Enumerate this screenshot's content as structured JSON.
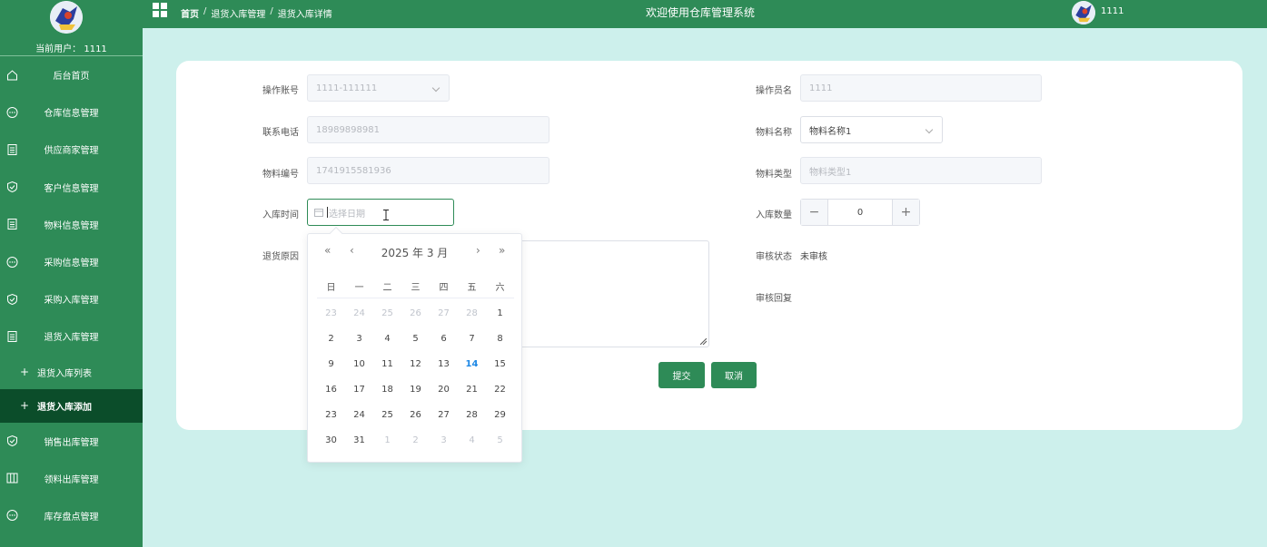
{
  "sidebar": {
    "current_user": "当前用户： 1111",
    "items": [
      {
        "label": "后台首页",
        "icon": "home-icon"
      },
      {
        "label": "仓库信息管理",
        "icon": "chat-icon"
      },
      {
        "label": "供应商家管理",
        "icon": "document-icon"
      },
      {
        "label": "客户信息管理",
        "icon": "shield-icon"
      },
      {
        "label": "物料信息管理",
        "icon": "document-icon"
      },
      {
        "label": "采购信息管理",
        "icon": "chat-icon"
      },
      {
        "label": "采购入库管理",
        "icon": "shield-icon"
      },
      {
        "label": "退货入库管理",
        "icon": "document-icon"
      }
    ],
    "subitems": [
      {
        "label": "退货入库列表"
      },
      {
        "label": "退货入库添加"
      }
    ],
    "items_after": [
      {
        "label": "销售出库管理",
        "icon": "shield-icon"
      },
      {
        "label": "领料出库管理",
        "icon": "columns-icon"
      },
      {
        "label": "库存盘点管理",
        "icon": "chat-icon"
      }
    ]
  },
  "topbar": {
    "breadcrumb": [
      "首页",
      "退货入库管理",
      "退货入库详情"
    ],
    "title": "欢迎使用仓库管理系统",
    "username": "1111"
  },
  "form": {
    "account_label": "操作账号",
    "account_value": "1111-111111",
    "operator_label": "操作员名",
    "operator_value": "1111",
    "phone_label": "联系电话",
    "phone_value": "18989898981",
    "material_name_label": "物料名称",
    "material_name_value": "物料名称1",
    "material_code_label": "物料编号",
    "material_code_value": "1741915581936",
    "material_type_label": "物料类型",
    "material_type_value": "物料类型1",
    "time_label": "入库时间",
    "time_placeholder": "选择日期",
    "qty_label": "入库数量",
    "qty_value": "0",
    "reason_label": "退货原因",
    "audit_status_label": "审核状态",
    "audit_status_value": "未审核",
    "audit_reply_label": "审核回复",
    "submit_label": "提交",
    "cancel_label": "取消"
  },
  "datepicker": {
    "title": "2025 年  3 月",
    "weekdays": [
      "日",
      "一",
      "二",
      "三",
      "四",
      "五",
      "六"
    ],
    "weeks": [
      [
        [
          "23",
          1
        ],
        [
          "24",
          1
        ],
        [
          "25",
          1
        ],
        [
          "26",
          1
        ],
        [
          "27",
          1
        ],
        [
          "28",
          1
        ],
        [
          "1",
          0
        ]
      ],
      [
        [
          "2",
          0
        ],
        [
          "3",
          0
        ],
        [
          "4",
          0
        ],
        [
          "5",
          0
        ],
        [
          "6",
          0
        ],
        [
          "7",
          0
        ],
        [
          "8",
          0
        ]
      ],
      [
        [
          "9",
          0
        ],
        [
          "10",
          0
        ],
        [
          "11",
          0
        ],
        [
          "12",
          0
        ],
        [
          "13",
          0
        ],
        [
          "14",
          2
        ],
        [
          "15",
          0
        ]
      ],
      [
        [
          "16",
          0
        ],
        [
          "17",
          0
        ],
        [
          "18",
          0
        ],
        [
          "19",
          0
        ],
        [
          "20",
          0
        ],
        [
          "21",
          0
        ],
        [
          "22",
          0
        ]
      ],
      [
        [
          "23",
          0
        ],
        [
          "24",
          0
        ],
        [
          "25",
          0
        ],
        [
          "26",
          0
        ],
        [
          "27",
          0
        ],
        [
          "28",
          0
        ],
        [
          "29",
          0
        ]
      ],
      [
        [
          "30",
          0
        ],
        [
          "31",
          0
        ],
        [
          "1",
          1
        ],
        [
          "2",
          1
        ],
        [
          "3",
          1
        ],
        [
          "4",
          1
        ],
        [
          "5",
          1
        ]
      ]
    ]
  },
  "colors": {
    "primary": "#2e8b57",
    "active_menu": "#0b4d2a",
    "background": "#cdf0ec",
    "today": "#1e88e5"
  }
}
